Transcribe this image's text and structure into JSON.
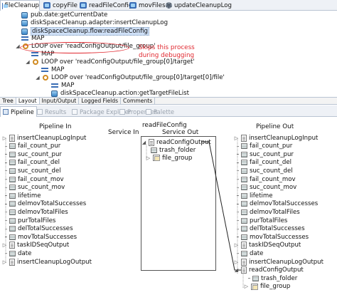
{
  "editor_tabs": [
    "fileCleanup",
    "copyFile",
    "readFileConfig",
    "movFiles",
    "updateCleanupLog"
  ],
  "flow_steps": [
    {
      "label": "pub.date:getCurrentDate",
      "icon": "invoke-icon"
    },
    {
      "label": "diskSpaceCleanup.adapter:insertCleanupLog",
      "icon": "invoke-icon"
    },
    {
      "label": "diskSpaceCleanup.flow:readFileConfig",
      "icon": "invoke-icon"
    },
    {
      "label": "MAP",
      "icon": "map-icon"
    },
    {
      "label": "LOOP over 'readConfigOutput/file_group'",
      "icon": "loop-icon"
    },
    {
      "label": "MAP",
      "icon": "map-icon"
    },
    {
      "label": "LOOP over 'readConfigOutput/file_group[0]/target'",
      "icon": "loop-icon"
    },
    {
      "label": "MAP",
      "icon": "map-icon"
    },
    {
      "label": "LOOP over 'readConfigOutput/file_group[0]/target[0]/file'",
      "icon": "loop-icon"
    },
    {
      "label": "MAP",
      "icon": "map-icon"
    },
    {
      "label": "diskSpaceCleanup.action:getTargetFileList",
      "icon": "invoke-icon"
    }
  ],
  "annotation": {
    "line1": "Skips this process",
    "line2": "during debugging",
    "color": "#e0282f"
  },
  "bottom_tabs": [
    "Tree",
    "Layout",
    "Input/Output",
    "Logged Fields",
    "Comments"
  ],
  "view_tabs": [
    "Pipeline",
    "Results",
    "Package Explorer",
    "Properties",
    "Palette"
  ],
  "pipeline": {
    "in_title": "Pipeline In",
    "out_title": "Pipeline Out",
    "service_title": "readFileConfig",
    "service_in": "Service In",
    "service_out": "Service Out",
    "in_vars": [
      "insertCleanupLogInput",
      "fail_count_pur",
      "suc_count_pur",
      "fail_count_del",
      "suc_count_del",
      "fail_count_mov",
      "suc_count_mov",
      "lifetime",
      "delmovTotalSuccesses",
      "delmovTotalFiles",
      "purTotalFiles",
      "delTotalSuccesses",
      "movTotalSuccesses",
      "taskIDSeqOutput",
      "date",
      "insertCleanupLogOutput"
    ],
    "out_vars": [
      "insertCleanupLogInput",
      "fail_count_pur",
      "suc_count_pur",
      "fail_count_del",
      "suc_count_del",
      "fail_count_mov",
      "suc_count_mov",
      "lifetime",
      "delmovTotalSuccesses",
      "delmovTotalFiles",
      "purTotalFiles",
      "delTotalSuccesses",
      "movTotalSuccesses",
      "taskIDSeqOutput",
      "date",
      "insertCleanupLogOutput",
      "readConfigOutput",
      "trash_folder",
      "file_group"
    ],
    "service_out_vars": [
      "readConfigOutput",
      "trash_folder",
      "file_group"
    ]
  }
}
